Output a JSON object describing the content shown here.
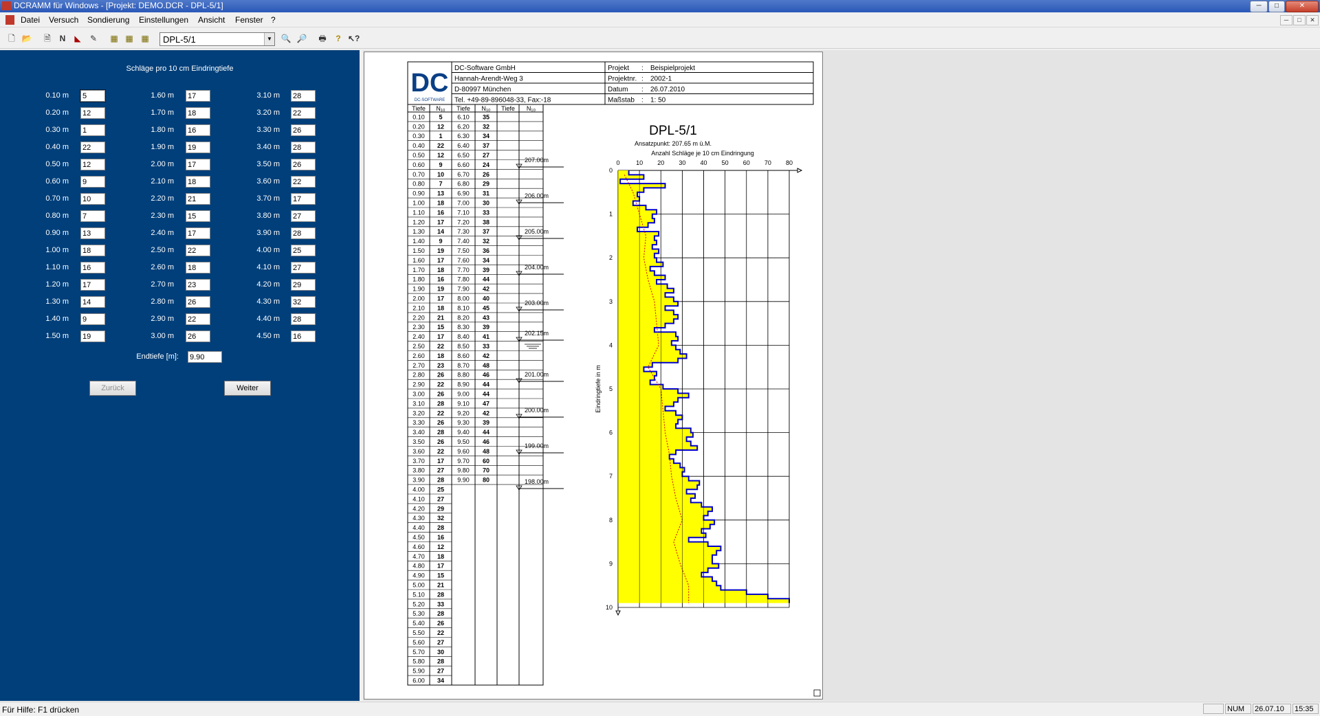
{
  "window": {
    "title": "DCRAMM für Windows - [Projekt: DEMO.DCR - DPL-5/1]",
    "minimize": "─",
    "maximize": "□",
    "close": "✕"
  },
  "menu": [
    "Datei",
    "Versuch",
    "Sondierung",
    "Einstellungen",
    "Ansicht",
    "Fenster",
    "?"
  ],
  "toolbar": {
    "combo_value": "DPL-5/1",
    "icons": [
      "new-file-icon",
      "open-folder-icon",
      "document-icon",
      "letter-n-icon",
      "angle-icon",
      "pencil-icon",
      "table-1-icon",
      "table-2-icon",
      "table-3-icon",
      "zoom-in-icon",
      "zoom-out-icon",
      "print-icon",
      "help-icon",
      "context-help-icon"
    ]
  },
  "input_panel": {
    "heading": "Schläge pro 10 cm Eindringtiefe",
    "col1": [
      {
        "depth": "0.10 m",
        "n": "5"
      },
      {
        "depth": "0.20 m",
        "n": "12"
      },
      {
        "depth": "0.30 m",
        "n": "1"
      },
      {
        "depth": "0.40 m",
        "n": "22"
      },
      {
        "depth": "0.50 m",
        "n": "12"
      },
      {
        "depth": "0.60 m",
        "n": "9"
      },
      {
        "depth": "0.70 m",
        "n": "10"
      },
      {
        "depth": "0.80 m",
        "n": "7"
      },
      {
        "depth": "0.90 m",
        "n": "13"
      },
      {
        "depth": "1.00 m",
        "n": "18"
      },
      {
        "depth": "1.10 m",
        "n": "16"
      },
      {
        "depth": "1.20 m",
        "n": "17"
      },
      {
        "depth": "1.30 m",
        "n": "14"
      },
      {
        "depth": "1.40 m",
        "n": "9"
      },
      {
        "depth": "1.50 m",
        "n": "19"
      }
    ],
    "col2": [
      {
        "depth": "1.60 m",
        "n": "17"
      },
      {
        "depth": "1.70 m",
        "n": "18"
      },
      {
        "depth": "1.80 m",
        "n": "16"
      },
      {
        "depth": "1.90 m",
        "n": "19"
      },
      {
        "depth": "2.00 m",
        "n": "17"
      },
      {
        "depth": "2.10 m",
        "n": "18"
      },
      {
        "depth": "2.20 m",
        "n": "21"
      },
      {
        "depth": "2.30 m",
        "n": "15"
      },
      {
        "depth": "2.40 m",
        "n": "17"
      },
      {
        "depth": "2.50 m",
        "n": "22"
      },
      {
        "depth": "2.60 m",
        "n": "18"
      },
      {
        "depth": "2.70 m",
        "n": "23"
      },
      {
        "depth": "2.80 m",
        "n": "26"
      },
      {
        "depth": "2.90 m",
        "n": "22"
      },
      {
        "depth": "3.00 m",
        "n": "26"
      }
    ],
    "col3": [
      {
        "depth": "3.10 m",
        "n": "28"
      },
      {
        "depth": "3.20 m",
        "n": "22"
      },
      {
        "depth": "3.30 m",
        "n": "26"
      },
      {
        "depth": "3.40 m",
        "n": "28"
      },
      {
        "depth": "3.50 m",
        "n": "26"
      },
      {
        "depth": "3.60 m",
        "n": "22"
      },
      {
        "depth": "3.70 m",
        "n": "17"
      },
      {
        "depth": "3.80 m",
        "n": "27"
      },
      {
        "depth": "3.90 m",
        "n": "28"
      },
      {
        "depth": "4.00 m",
        "n": "25"
      },
      {
        "depth": "4.10 m",
        "n": "27"
      },
      {
        "depth": "4.20 m",
        "n": "29"
      },
      {
        "depth": "4.30 m",
        "n": "32"
      },
      {
        "depth": "4.40 m",
        "n": "28"
      },
      {
        "depth": "4.50 m",
        "n": "16"
      }
    ],
    "endtiefe_label": "Endtiefe [m]:",
    "endtiefe_value": "9.90",
    "back_button": "Zurück",
    "next_button": "Weiter"
  },
  "report": {
    "company": [
      "DC-Software GmbH",
      "Hannah-Arendt-Weg 3",
      "D-80997 München",
      "Tel. +49-89-896048-33, Fax:-18"
    ],
    "logo_text": "DC",
    "logo_sub": "DC-SOFTWARE",
    "meta": [
      {
        "label": "Projekt",
        "value": "Beispielprojekt"
      },
      {
        "label": "Projektnr.",
        "value": "2002-1"
      },
      {
        "label": "Datum",
        "value": "26.07.2010"
      },
      {
        "label": "Maßstab",
        "value": "1: 50"
      }
    ],
    "table_headers": [
      "Tiefe",
      "N₁₀",
      "Tiefe",
      "N₁₀",
      "Tiefe",
      "N₁₀"
    ],
    "table_rows_a": [
      [
        "0.10",
        "5"
      ],
      [
        "0.20",
        "12"
      ],
      [
        "0.30",
        "1"
      ],
      [
        "0.40",
        "22"
      ],
      [
        "0.50",
        "12"
      ],
      [
        "0.60",
        "9"
      ],
      [
        "0.70",
        "10"
      ],
      [
        "0.80",
        "7"
      ],
      [
        "0.90",
        "13"
      ],
      [
        "1.00",
        "18"
      ],
      [
        "1.10",
        "16"
      ],
      [
        "1.20",
        "17"
      ],
      [
        "1.30",
        "14"
      ],
      [
        "1.40",
        "9"
      ],
      [
        "1.50",
        "19"
      ],
      [
        "1.60",
        "17"
      ],
      [
        "1.70",
        "18"
      ],
      [
        "1.80",
        "16"
      ],
      [
        "1.90",
        "19"
      ],
      [
        "2.00",
        "17"
      ],
      [
        "2.10",
        "18"
      ],
      [
        "2.20",
        "21"
      ],
      [
        "2.30",
        "15"
      ],
      [
        "2.40",
        "17"
      ],
      [
        "2.50",
        "22"
      ],
      [
        "2.60",
        "18"
      ],
      [
        "2.70",
        "23"
      ],
      [
        "2.80",
        "26"
      ],
      [
        "2.90",
        "22"
      ],
      [
        "3.00",
        "26"
      ],
      [
        "3.10",
        "28"
      ],
      [
        "3.20",
        "22"
      ],
      [
        "3.30",
        "26"
      ],
      [
        "3.40",
        "28"
      ],
      [
        "3.50",
        "26"
      ],
      [
        "3.60",
        "22"
      ],
      [
        "3.70",
        "17"
      ],
      [
        "3.80",
        "27"
      ],
      [
        "3.90",
        "28"
      ],
      [
        "4.00",
        "25"
      ],
      [
        "4.10",
        "27"
      ],
      [
        "4.20",
        "29"
      ],
      [
        "4.30",
        "32"
      ],
      [
        "4.40",
        "28"
      ],
      [
        "4.50",
        "16"
      ],
      [
        "4.60",
        "12"
      ],
      [
        "4.70",
        "18"
      ],
      [
        "4.80",
        "17"
      ],
      [
        "4.90",
        "15"
      ],
      [
        "5.00",
        "21"
      ],
      [
        "5.10",
        "28"
      ],
      [
        "5.20",
        "33"
      ],
      [
        "5.30",
        "28"
      ],
      [
        "5.40",
        "26"
      ],
      [
        "5.50",
        "22"
      ],
      [
        "5.60",
        "27"
      ],
      [
        "5.70",
        "30"
      ],
      [
        "5.80",
        "28"
      ],
      [
        "5.90",
        "27"
      ],
      [
        "6.00",
        "34"
      ]
    ],
    "table_rows_b": [
      [
        "6.10",
        "35"
      ],
      [
        "6.20",
        "32"
      ],
      [
        "6.30",
        "34"
      ],
      [
        "6.40",
        "37"
      ],
      [
        "6.50",
        "27"
      ],
      [
        "6.60",
        "24"
      ],
      [
        "6.70",
        "26"
      ],
      [
        "6.80",
        "29"
      ],
      [
        "6.90",
        "31"
      ],
      [
        "7.00",
        "30"
      ],
      [
        "7.10",
        "33"
      ],
      [
        "7.20",
        "38"
      ],
      [
        "7.30",
        "37"
      ],
      [
        "7.40",
        "32"
      ],
      [
        "7.50",
        "36"
      ],
      [
        "7.60",
        "34"
      ],
      [
        "7.70",
        "39"
      ],
      [
        "7.80",
        "44"
      ],
      [
        "7.90",
        "42"
      ],
      [
        "8.00",
        "40"
      ],
      [
        "8.10",
        "45"
      ],
      [
        "8.20",
        "43"
      ],
      [
        "8.30",
        "39"
      ],
      [
        "8.40",
        "41"
      ],
      [
        "8.50",
        "33"
      ],
      [
        "8.60",
        "42"
      ],
      [
        "8.70",
        "48"
      ],
      [
        "8.80",
        "46"
      ],
      [
        "8.90",
        "44"
      ],
      [
        "9.00",
        "44"
      ],
      [
        "9.10",
        "47"
      ],
      [
        "9.20",
        "42"
      ],
      [
        "9.30",
        "39"
      ],
      [
        "9.40",
        "44"
      ],
      [
        "9.50",
        "46"
      ],
      [
        "9.60",
        "48"
      ],
      [
        "9.70",
        "60"
      ],
      [
        "9.80",
        "70"
      ],
      [
        "9.90",
        "80"
      ]
    ],
    "elevations": [
      "207.00m",
      "206.00m",
      "205.00m",
      "204.00m",
      "203.00m",
      "202.15m",
      "201.00m",
      "200.00m",
      "199.00m",
      "198.00m"
    ],
    "chart_title": "DPL-5/1",
    "ansatzpunkt": "Ansatzpunkt: 207.65 m ü.M.",
    "x_axis_label": "Anzahl Schläge je 10 cm Eindringung",
    "y_axis_label": "Eindringtiefe in m",
    "colors": {
      "fill": "#ffff00",
      "step": "#0000cc",
      "trend": "#d00000"
    }
  },
  "chart_data": {
    "type": "area",
    "title": "DPL-5/1",
    "subtitle": "Ansatzpunkt: 207.65 m ü.M.",
    "xlabel": "Anzahl Schläge je 10 cm Eindringung",
    "ylabel": "Eindringtiefe in m",
    "xlim": [
      0,
      80
    ],
    "ylim": [
      0,
      10
    ],
    "x_ticks": [
      "0",
      "10",
      "20",
      "30",
      "40",
      "50",
      "60",
      "70",
      "80"
    ],
    "y_ticks": [
      "0",
      "1",
      "2",
      "3",
      "4",
      "5",
      "6",
      "7",
      "8",
      "9",
      "10"
    ],
    "depth": [
      0.1,
      0.2,
      0.3,
      0.4,
      0.5,
      0.6,
      0.7,
      0.8,
      0.9,
      1.0,
      1.1,
      1.2,
      1.3,
      1.4,
      1.5,
      1.6,
      1.7,
      1.8,
      1.9,
      2.0,
      2.1,
      2.2,
      2.3,
      2.4,
      2.5,
      2.6,
      2.7,
      2.8,
      2.9,
      3.0,
      3.1,
      3.2,
      3.3,
      3.4,
      3.5,
      3.6,
      3.7,
      3.8,
      3.9,
      4.0,
      4.1,
      4.2,
      4.3,
      4.4,
      4.5,
      4.6,
      4.7,
      4.8,
      4.9,
      5.0,
      5.1,
      5.2,
      5.3,
      5.4,
      5.5,
      5.6,
      5.7,
      5.8,
      5.9,
      6.0,
      6.1,
      6.2,
      6.3,
      6.4,
      6.5,
      6.6,
      6.7,
      6.8,
      6.9,
      7.0,
      7.1,
      7.2,
      7.3,
      7.4,
      7.5,
      7.6,
      7.7,
      7.8,
      7.9,
      8.0,
      8.1,
      8.2,
      8.3,
      8.4,
      8.5,
      8.6,
      8.7,
      8.8,
      8.9,
      9.0,
      9.1,
      9.2,
      9.3,
      9.4,
      9.5,
      9.6,
      9.7,
      9.8,
      9.9
    ],
    "n10": [
      5,
      12,
      1,
      22,
      12,
      9,
      10,
      7,
      13,
      18,
      16,
      17,
      14,
      9,
      19,
      17,
      18,
      16,
      19,
      17,
      18,
      21,
      15,
      17,
      22,
      18,
      23,
      26,
      22,
      26,
      28,
      22,
      26,
      28,
      26,
      22,
      17,
      27,
      28,
      25,
      27,
      29,
      32,
      28,
      16,
      12,
      18,
      17,
      15,
      21,
      28,
      33,
      28,
      26,
      22,
      27,
      30,
      28,
      27,
      34,
      35,
      32,
      34,
      37,
      27,
      24,
      26,
      29,
      31,
      30,
      33,
      38,
      37,
      32,
      36,
      34,
      39,
      44,
      42,
      40,
      45,
      43,
      39,
      41,
      33,
      42,
      48,
      46,
      44,
      44,
      47,
      42,
      39,
      44,
      46,
      48,
      60,
      70,
      80
    ],
    "trend": [
      [
        0.1,
        3
      ],
      [
        0.5,
        7
      ],
      [
        1.0,
        10
      ],
      [
        1.5,
        13
      ],
      [
        2.0,
        12
      ],
      [
        2.5,
        14
      ],
      [
        3.0,
        17
      ],
      [
        3.5,
        18
      ],
      [
        4.0,
        19
      ],
      [
        4.5,
        14
      ],
      [
        5.0,
        20
      ],
      [
        5.5,
        21
      ],
      [
        6.0,
        22
      ],
      [
        6.5,
        24
      ],
      [
        7.0,
        25
      ],
      [
        7.5,
        27
      ],
      [
        8.0,
        30
      ],
      [
        8.5,
        26
      ],
      [
        9.0,
        29
      ],
      [
        9.5,
        33
      ],
      [
        9.9,
        33
      ]
    ]
  },
  "statusbar": {
    "help": "Für Hilfe: F1 drücken",
    "num": "NUM",
    "date": "26.07.10",
    "time": "15:35"
  }
}
